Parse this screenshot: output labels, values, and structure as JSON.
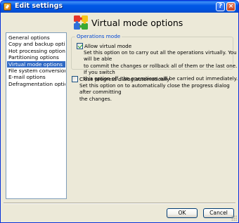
{
  "window": {
    "title": "Edit settings",
    "help_label": "?",
    "close_label": "×"
  },
  "sidebar": {
    "items": [
      {
        "label": "General options"
      },
      {
        "label": "Copy and backup options"
      },
      {
        "label": "Hot processing options"
      },
      {
        "label": "Partitioning options"
      },
      {
        "label": "Virtual mode options",
        "selected": true
      },
      {
        "label": "File system conversion options"
      },
      {
        "label": "E-mail options"
      },
      {
        "label": "Defragmentation options"
      }
    ]
  },
  "panel": {
    "title": "Virtual mode options",
    "icon": "puzzle-icon",
    "group_label": "Operations mode",
    "allow_virtual": {
      "label": "Allow virtual mode",
      "checked": true,
      "description_lines": [
        "Set this option on to carry out all the operations virtually. You will be able",
        "to commit the changes or rollback all of them or the last one. If you switch",
        "this option off, the operations will be carried out immediately."
      ]
    },
    "close_progress": {
      "label": "Close progress dialog automatically",
      "checked": false,
      "description_lines": [
        "Set this option on to automatically close the progress dialog after committing",
        "the changes."
      ]
    }
  },
  "buttons": {
    "ok_label": "OK",
    "cancel_label": "Cancel"
  },
  "colors": {
    "titlebar": "#0058e6",
    "selection": "#316ac5",
    "group_label": "#0046d5",
    "dialog_bg": "#ece9d8"
  }
}
